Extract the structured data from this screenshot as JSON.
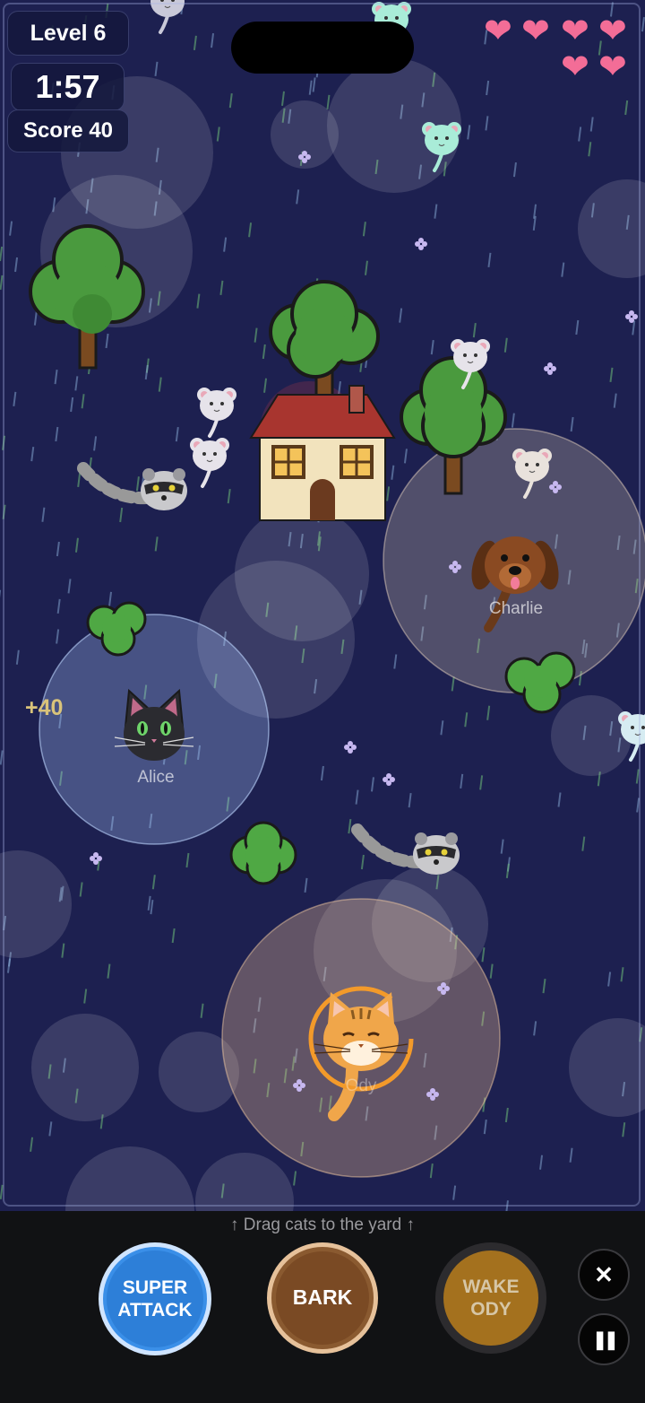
{
  "hud": {
    "level": "Level 6",
    "timer": "1:57",
    "score": "Score 40",
    "lives": 6
  },
  "hearts": [
    "❤",
    "❤",
    "❤",
    "❤",
    "❤",
    "❤"
  ],
  "characters": {
    "alice": "Alice",
    "charlie": "Charlie",
    "ody": "Ody"
  },
  "popup": "+40",
  "controls": {
    "hint": "↑  Drag cats to the yard  ↑",
    "super_attack": "SUPER\nATTACK",
    "bark": "BARK",
    "wake": "WAKE\nODY",
    "close": "✕",
    "pause": "❚❚"
  },
  "colors": {
    "field": "#1d2050",
    "heart": "#f36d97",
    "super": "#2d7fd8",
    "bark": "#7a4a24",
    "wake": "#a4711e"
  }
}
